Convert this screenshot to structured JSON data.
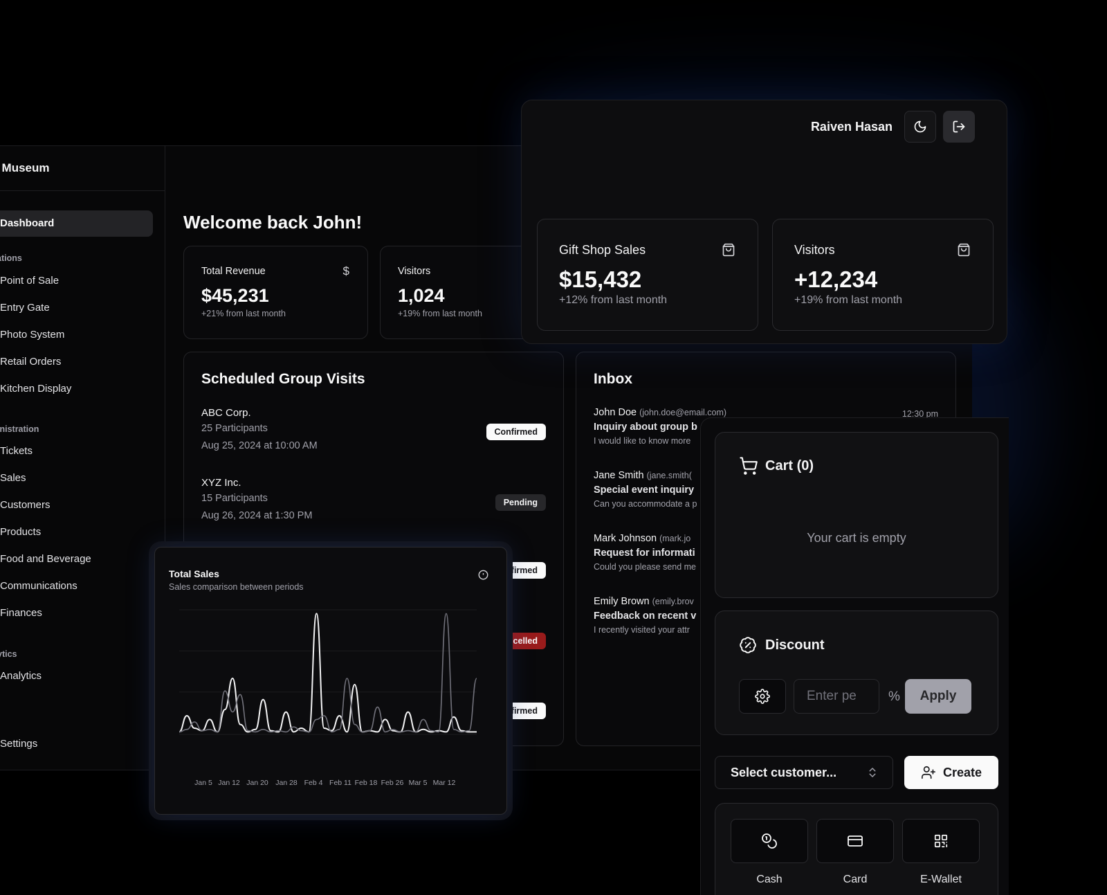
{
  "sidebar": {
    "brand": "he Museum",
    "active_item": "Dashboard",
    "section_operations": "ations",
    "operations": [
      "Point of Sale",
      "Entry Gate",
      "Photo System",
      "Retail Orders",
      "Kitchen Display"
    ],
    "section_administration": "inistration",
    "administration": [
      "Tickets",
      "Sales",
      "Customers",
      "Products",
      "Food and Beverage",
      "Communications",
      "Finances"
    ],
    "section_analytics": "ytics",
    "analytics": [
      "Analytics"
    ],
    "settings": "Settings"
  },
  "main": {
    "welcome": "Welcome back John!",
    "stats": [
      {
        "title": "Total Revenue",
        "value": "$45,231",
        "sub": "+21% from last month",
        "icon": "dollar-icon"
      },
      {
        "title": "Visitors",
        "value": "1,024",
        "sub": "+19% from last month"
      }
    ],
    "visits": {
      "title": "Scheduled Group Visits",
      "items": [
        {
          "name": "ABC Corp.",
          "participants": "25 Participants",
          "date": "Aug 25, 2024 at 10:00 AM",
          "status": "Confirmed"
        },
        {
          "name": "XYZ Inc.",
          "participants": "15 Participants",
          "date": "Aug 26, 2024 at 1:30 PM",
          "status": "Pending"
        }
      ],
      "hidden_badges": [
        "firmed",
        "ncelled",
        "firmed"
      ]
    },
    "inbox": {
      "title": "Inbox",
      "items": [
        {
          "name": "John Doe",
          "email": "(john.doe@email.com)",
          "subject": "Inquiry about group b",
          "preview": "I would like to know more",
          "time": "12:30 pm"
        },
        {
          "name": "Jane Smith",
          "email": "(jane.smith(",
          "subject": "Special event inquiry",
          "preview": "Can you accommodate a p"
        },
        {
          "name": "Mark Johnson",
          "email": "(mark.jo",
          "subject": "Request for informati",
          "preview": "Could you please send me"
        },
        {
          "name": "Emily Brown",
          "email": "(emily.brov",
          "subject": "Feedback on recent v",
          "preview": "I recently visited your attr"
        }
      ]
    }
  },
  "header": {
    "user_name": "Raiven Hasan",
    "theme_icon": "moon-icon",
    "logout_icon": "logout-icon"
  },
  "top_stats": [
    {
      "title": "Gift Shop Sales",
      "value": "$15,432",
      "sub": "+12% from last month",
      "icon": "shopping-bag-icon"
    },
    {
      "title": "Visitors",
      "value": "+12,234",
      "sub": "+19% from last month",
      "icon": "shopping-bag-icon"
    }
  ],
  "total_sales": {
    "title": "Total Sales",
    "subtitle": "Sales comparison between periods",
    "x_labels": [
      "Jan 5",
      "Jan 12",
      "Jan 20",
      "Jan 28",
      "Feb 4",
      "Feb 11",
      "Feb 18",
      "Feb 26",
      "Mar 5",
      "Mar 12"
    ]
  },
  "chart_data": {
    "type": "line",
    "title": "Total Sales",
    "subtitle": "Sales comparison between periods",
    "x_ticks": [
      "Jan 5",
      "Jan 12",
      "Jan 20",
      "Jan 28",
      "Feb 4",
      "Feb 11",
      "Feb 18",
      "Feb 26",
      "Mar 5",
      "Mar 12"
    ],
    "grid": true,
    "series": [
      {
        "values": [
          2,
          15,
          5,
          3,
          12,
          2,
          20,
          45,
          8,
          2,
          4,
          28,
          3,
          2,
          18,
          2,
          5,
          2,
          97,
          5,
          3,
          15,
          2,
          40,
          2,
          3,
          2,
          12,
          3,
          2,
          18,
          2,
          4,
          2,
          3,
          2,
          14,
          3,
          2,
          2
        ]
      },
      {
        "values": [
          2,
          4,
          10,
          3,
          4,
          2,
          35,
          18,
          32,
          3,
          2,
          4,
          2,
          3,
          2,
          6,
          3,
          2,
          12,
          15,
          2,
          4,
          45,
          8,
          2,
          3,
          22,
          2,
          4,
          2,
          3,
          2,
          12,
          3,
          2,
          97,
          4,
          2,
          3,
          45
        ]
      }
    ]
  },
  "cart": {
    "title": "Cart (0)",
    "empty": "Your cart is empty"
  },
  "discount": {
    "title": "Discount",
    "placeholder": "Enter pe",
    "percent": "%",
    "apply": "Apply"
  },
  "customer": {
    "select": "Select customer...",
    "create": "Create"
  },
  "payment": [
    {
      "label": "Cash",
      "icon": "coins-icon"
    },
    {
      "label": "Card",
      "icon": "credit-card-icon"
    },
    {
      "label": "E-Wallet",
      "icon": "qr-code-icon"
    }
  ]
}
